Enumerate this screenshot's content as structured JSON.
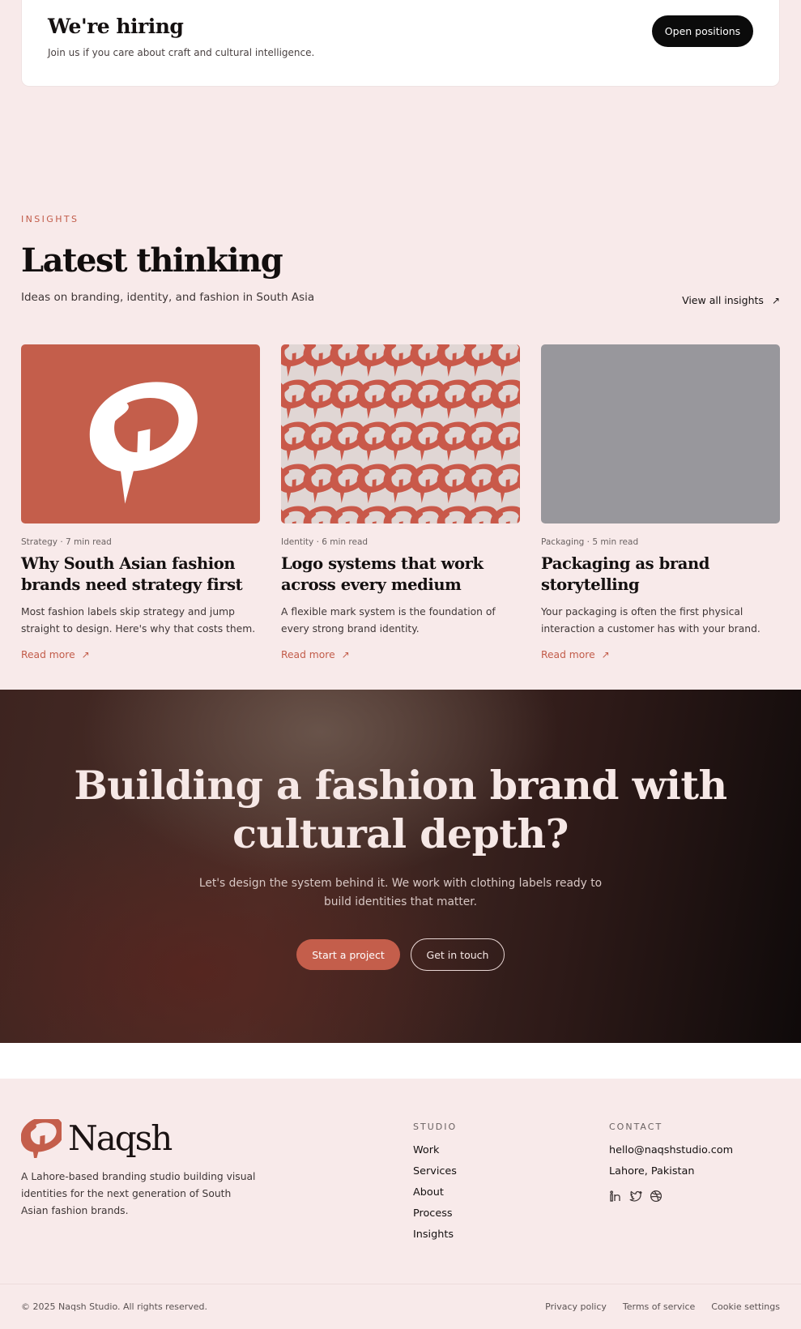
{
  "hiring": {
    "title": "We're hiring",
    "subtitle": "Join us if you care about craft and cultural intelligence.",
    "button_label": "Open positions"
  },
  "insights": {
    "eyebrow": "INSIGHTS",
    "title": "Latest thinking",
    "subtitle": "Ideas on branding, identity, and fashion in South Asia",
    "view_all_label": "View all insights",
    "cards": [
      {
        "meta": "Strategy · 7 min read",
        "title": "Why South Asian fashion brands need strategy first",
        "text": "Most fashion labels skip strategy and jump straight to design. Here's why that costs them.",
        "link": "Read more"
      },
      {
        "meta": "Identity · 6 min read",
        "title": "Logo systems that work across every medium",
        "text": "A flexible mark system is the foundation of every strong brand identity.",
        "link": "Read more"
      },
      {
        "meta": "Packaging · 5 min read",
        "title": "Packaging as brand storytelling",
        "text": "Your packaging is often the first physical interaction a customer has with your brand.",
        "link": "Read more"
      }
    ]
  },
  "cta": {
    "title": "Building a fashion brand with cultural depth?",
    "subtitle": "Let's design the system behind it. We work with clothing labels ready to build identities that matter.",
    "primary_label": "Start a project",
    "secondary_label": "Get in touch"
  },
  "footer": {
    "brand_name": "Naqsh",
    "description": "A Lahore-based branding studio building visual identities for the next generation of South Asian fashion brands.",
    "studio": {
      "title": "STUDIO",
      "links": [
        "Work",
        "Services",
        "About",
        "Process",
        "Insights"
      ]
    },
    "contact": {
      "title": "CONTACT",
      "email": "hello@naqshstudio.com",
      "location": "Lahore, Pakistan",
      "socials": [
        "linkedin-icon",
        "twitter-icon",
        "dribbble-icon"
      ]
    },
    "copyright": "© 2025 Naqsh Studio. All rights reserved.",
    "legal": [
      "Privacy policy",
      "Terms of service",
      "Cookie settings"
    ]
  },
  "colors": {
    "accent": "#c45e4b",
    "background": "#f8eaea",
    "dark": "#0b0b0b"
  }
}
